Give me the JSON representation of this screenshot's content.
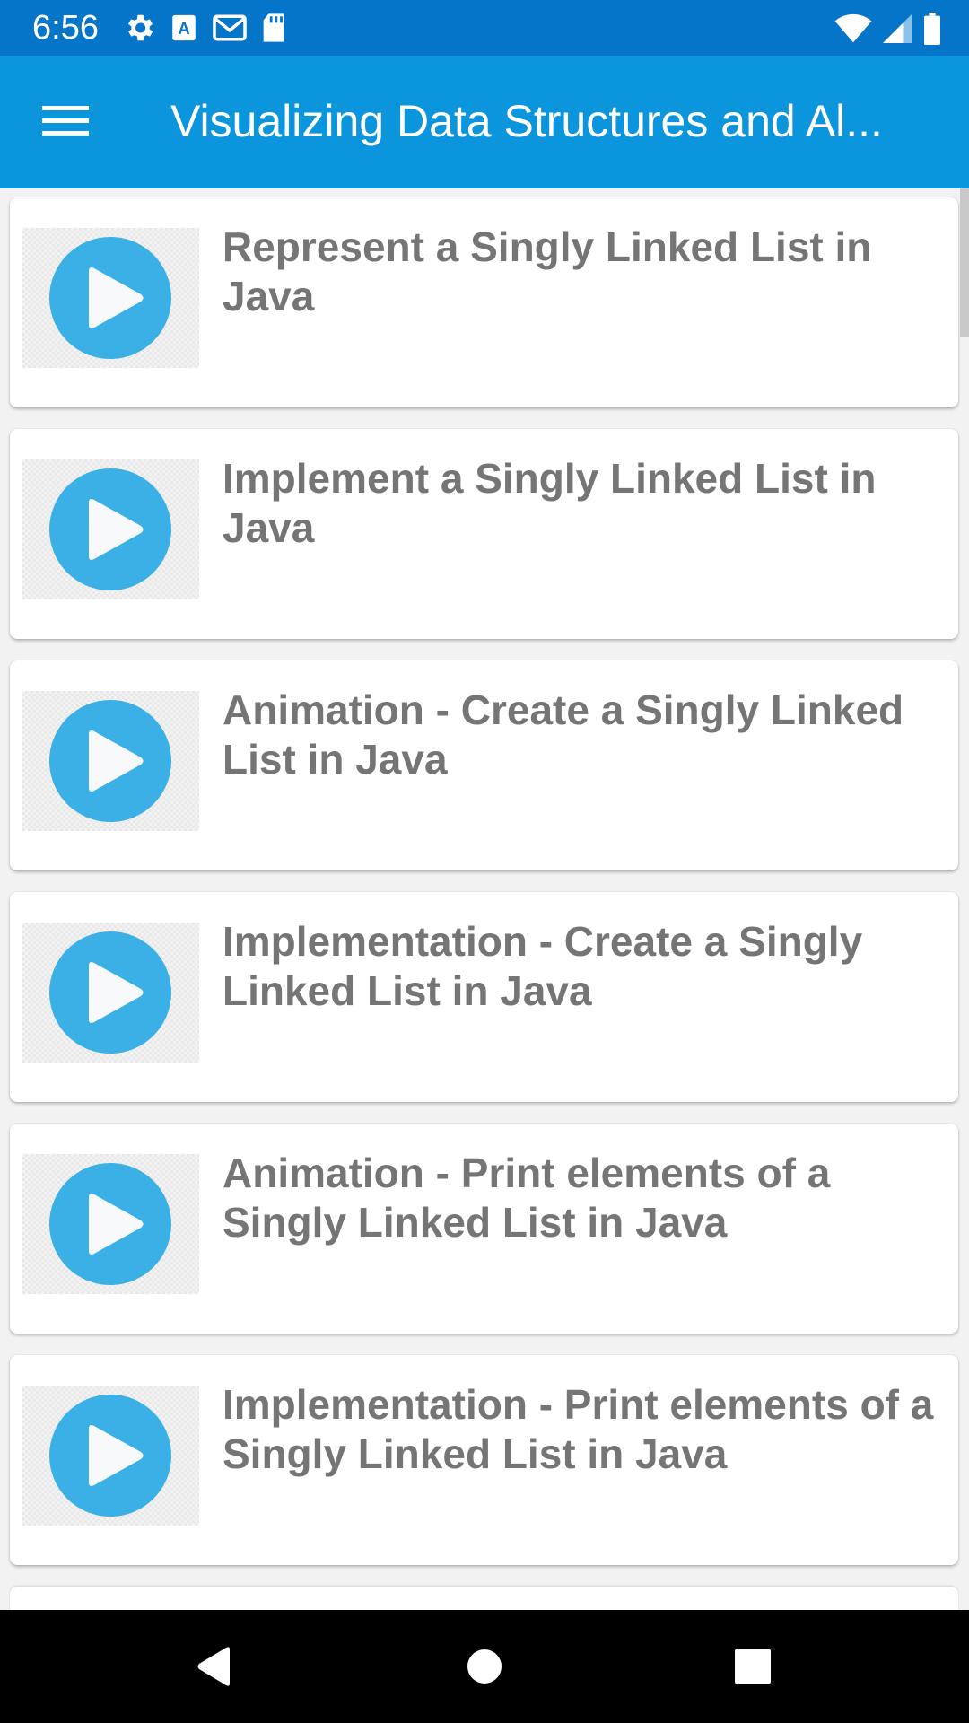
{
  "status_bar": {
    "time": "6:56",
    "icons_left": [
      "settings-icon",
      "text-a-icon",
      "gmail-icon",
      "sd-card-icon"
    ],
    "icons_right": [
      "wifi-icon",
      "cellular-signal-icon",
      "battery-icon"
    ]
  },
  "app_bar": {
    "menu_icon": "hamburger-menu-icon",
    "title": "Visualizing Data Structures and Al..."
  },
  "videos": [
    {
      "title": "Represent a Singly Linked List in Java"
    },
    {
      "title": "Implement a Singly Linked List in Java"
    },
    {
      "title": "Animation - Create a Singly Linked List in Java"
    },
    {
      "title": "Implementation - Create a Singly Linked List in Java"
    },
    {
      "title": "Animation - Print elements of a Singly Linked List in Java"
    },
    {
      "title": "Implementation - Print elements of a Singly Linked List in Java"
    }
  ],
  "nav_bar": {
    "back_icon": "back-triangle-icon",
    "home_icon": "home-circle-icon",
    "recents_icon": "recents-square-icon"
  },
  "colors": {
    "status_bar": "#0575c9",
    "app_bar": "#0a95dc",
    "play_button": "#3ab0e6",
    "title_text": "#757575",
    "background": "#f2f2f2"
  }
}
